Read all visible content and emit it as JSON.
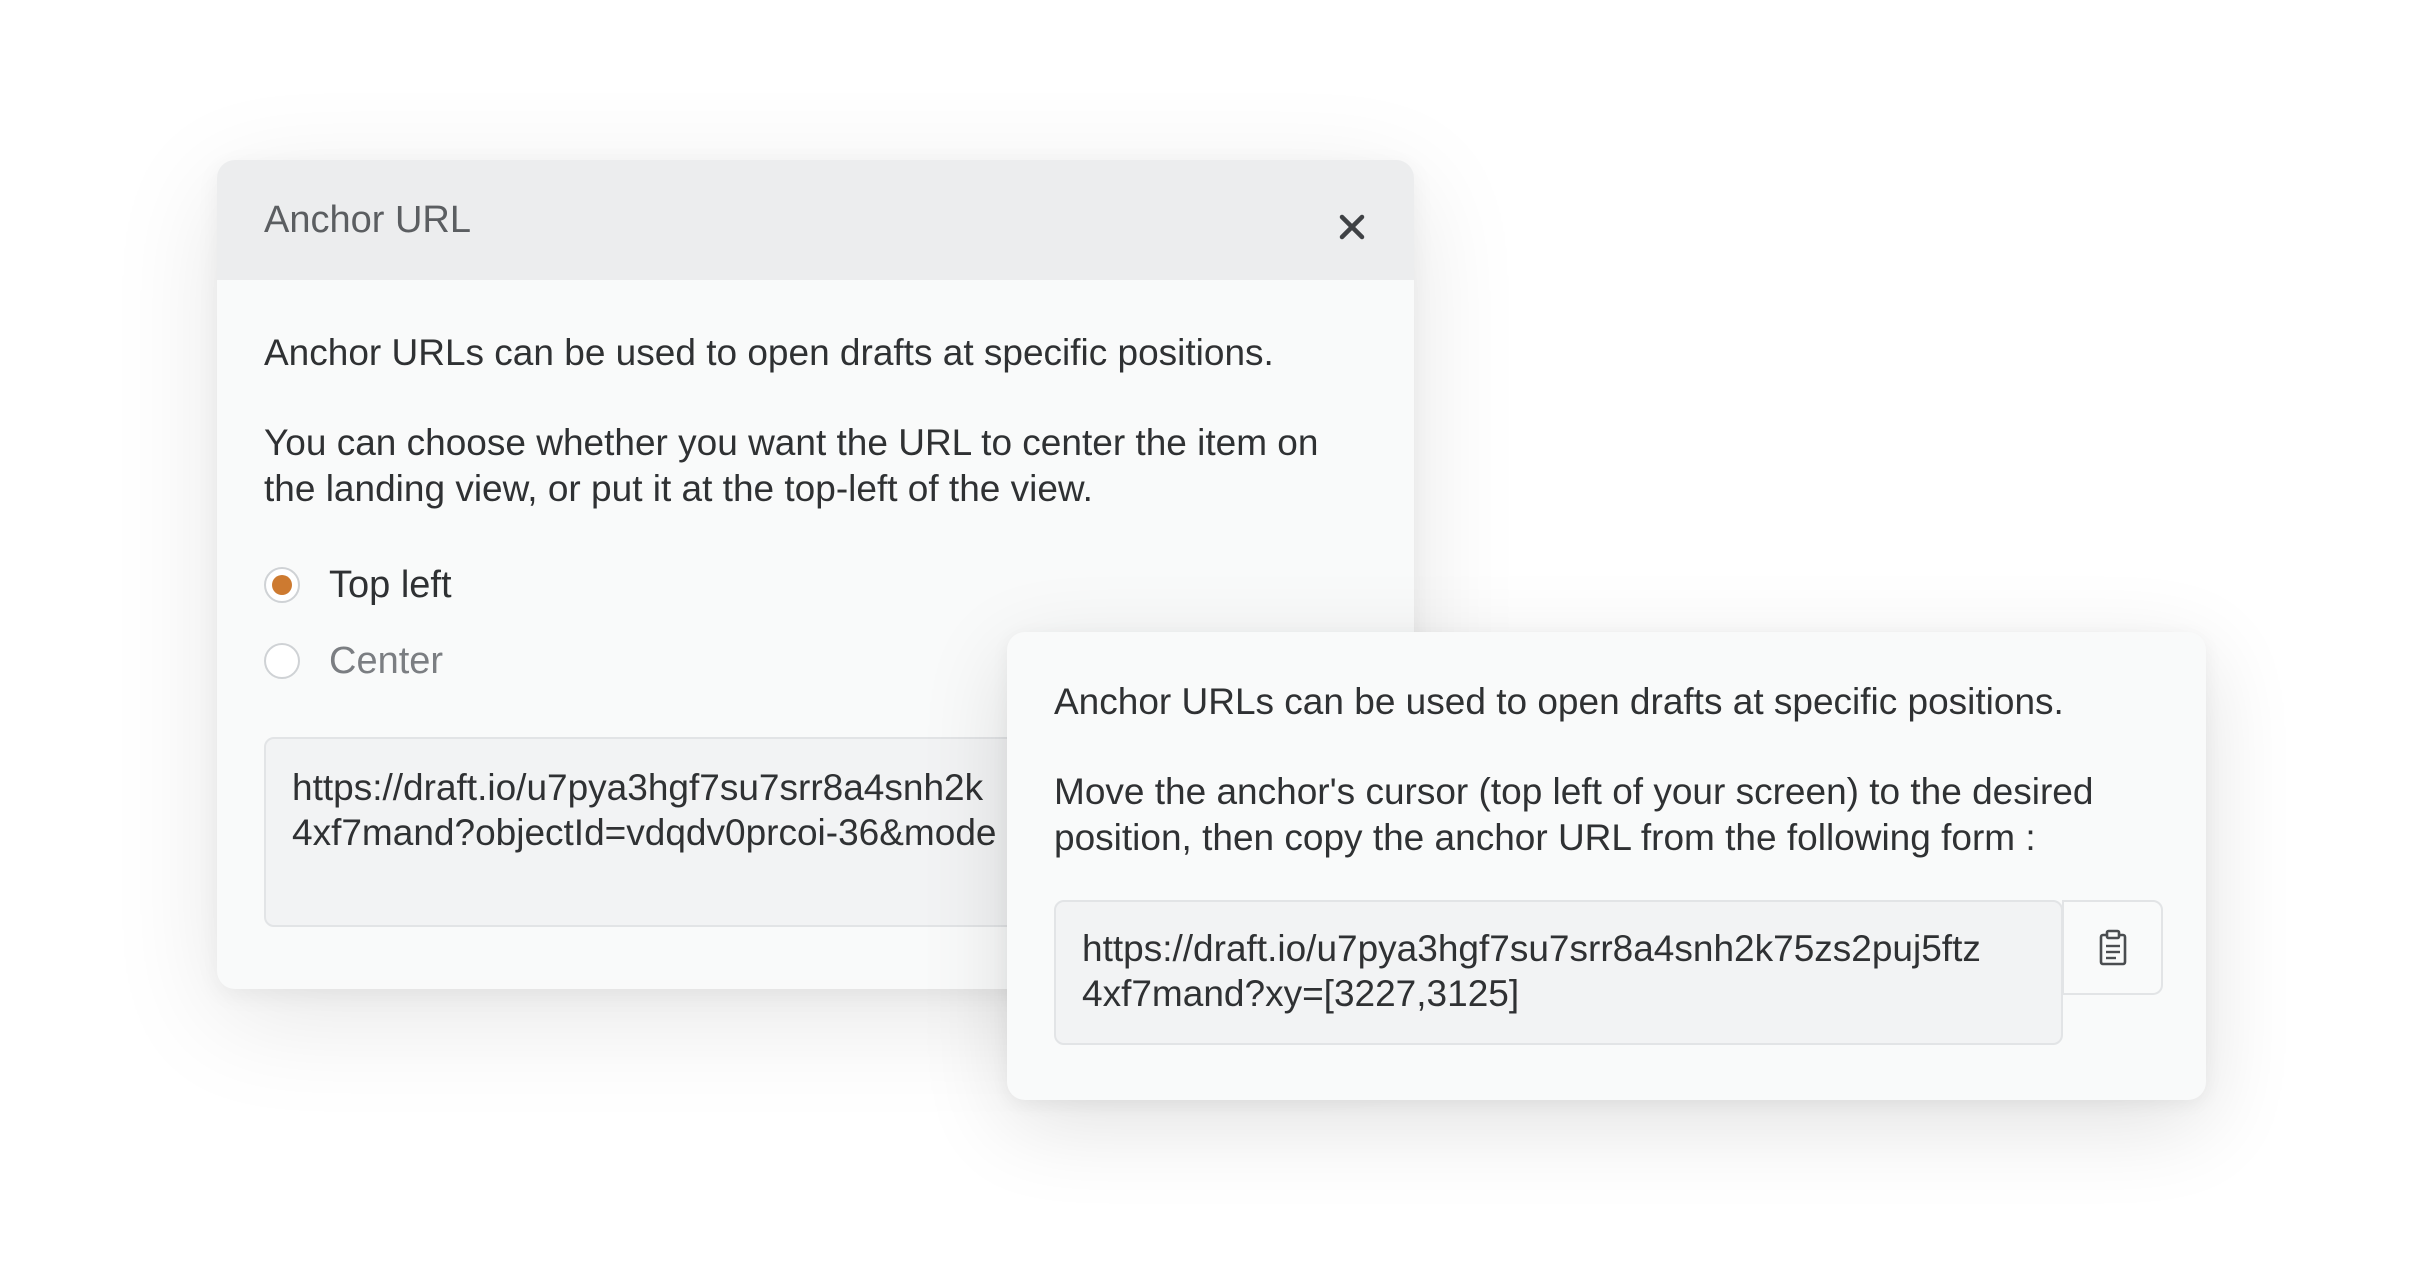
{
  "anchor_dialog": {
    "title": "Anchor URL",
    "intro": "Anchor URLs can be used to open drafts at specific positions.",
    "description": "You can choose whether you want the URL to center the item on the landing view, or put it at the top-left of the view.",
    "options": [
      {
        "label": "Top left",
        "selected": true
      },
      {
        "label": "Center",
        "selected": false
      }
    ],
    "url_lines": [
      "https://draft.io/u7pya3hgf7su7srr8a4snh2k",
      "4xf7mand?objectId=vdqdv0prcoi-36&mode"
    ],
    "close_icon": "close-icon",
    "accent_color": "#cd7a30"
  },
  "cursor_card": {
    "intro": "Anchor URLs can be used to open drafts at specific positions.",
    "description": "Move the anchor's cursor (top left of your screen) to the desired position, then copy the anchor URL from the following form :",
    "url_lines": [
      "https://draft.io/u7pya3hgf7su7srr8a4snh2k75zs2puj5ftz",
      "4xf7mand?xy=[3227,3125]"
    ],
    "copy_icon": "clipboard-icon"
  }
}
